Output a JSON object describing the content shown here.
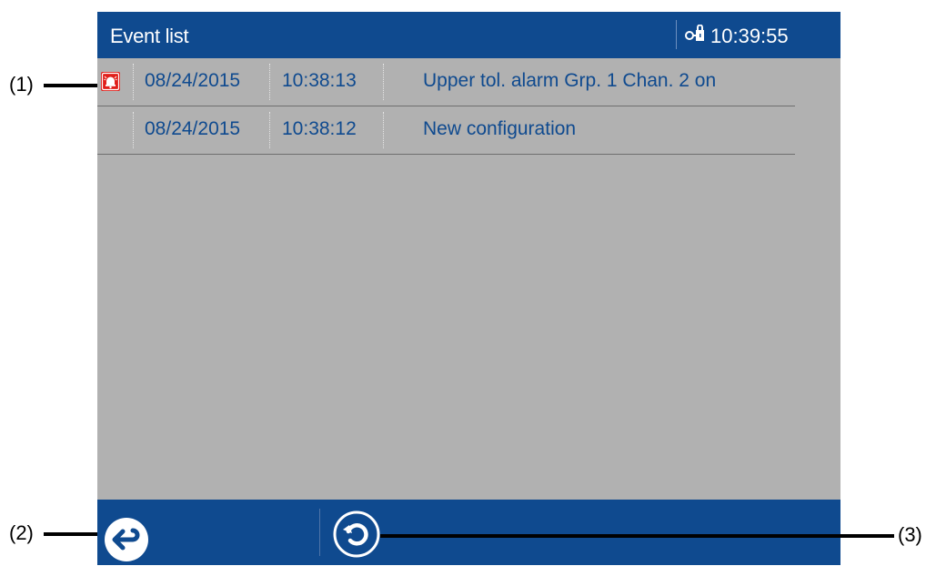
{
  "titlebar": {
    "title": "Event list",
    "time": "10:39:55",
    "lock_icon": "lock-key-icon"
  },
  "events": [
    {
      "icon": "alarm-bell-icon",
      "date": "08/24/2015",
      "time": "10:38:13",
      "text": "Upper tol. alarm Grp. 1 Chan. 2 on"
    },
    {
      "icon": "",
      "date": "08/24/2015",
      "time": "10:38:12",
      "text": "New configuration"
    }
  ],
  "toolbar": {
    "back_icon": "back-arrow-icon",
    "refresh_icon": "refresh-icon"
  },
  "callouts": [
    "(1)",
    "(2)",
    "(3)"
  ],
  "colors": {
    "bar": "#0f4a8f",
    "screen_bg": "#b1b1b1",
    "row_text": "#0f4a8f",
    "alarm_red": "#e0201b"
  }
}
